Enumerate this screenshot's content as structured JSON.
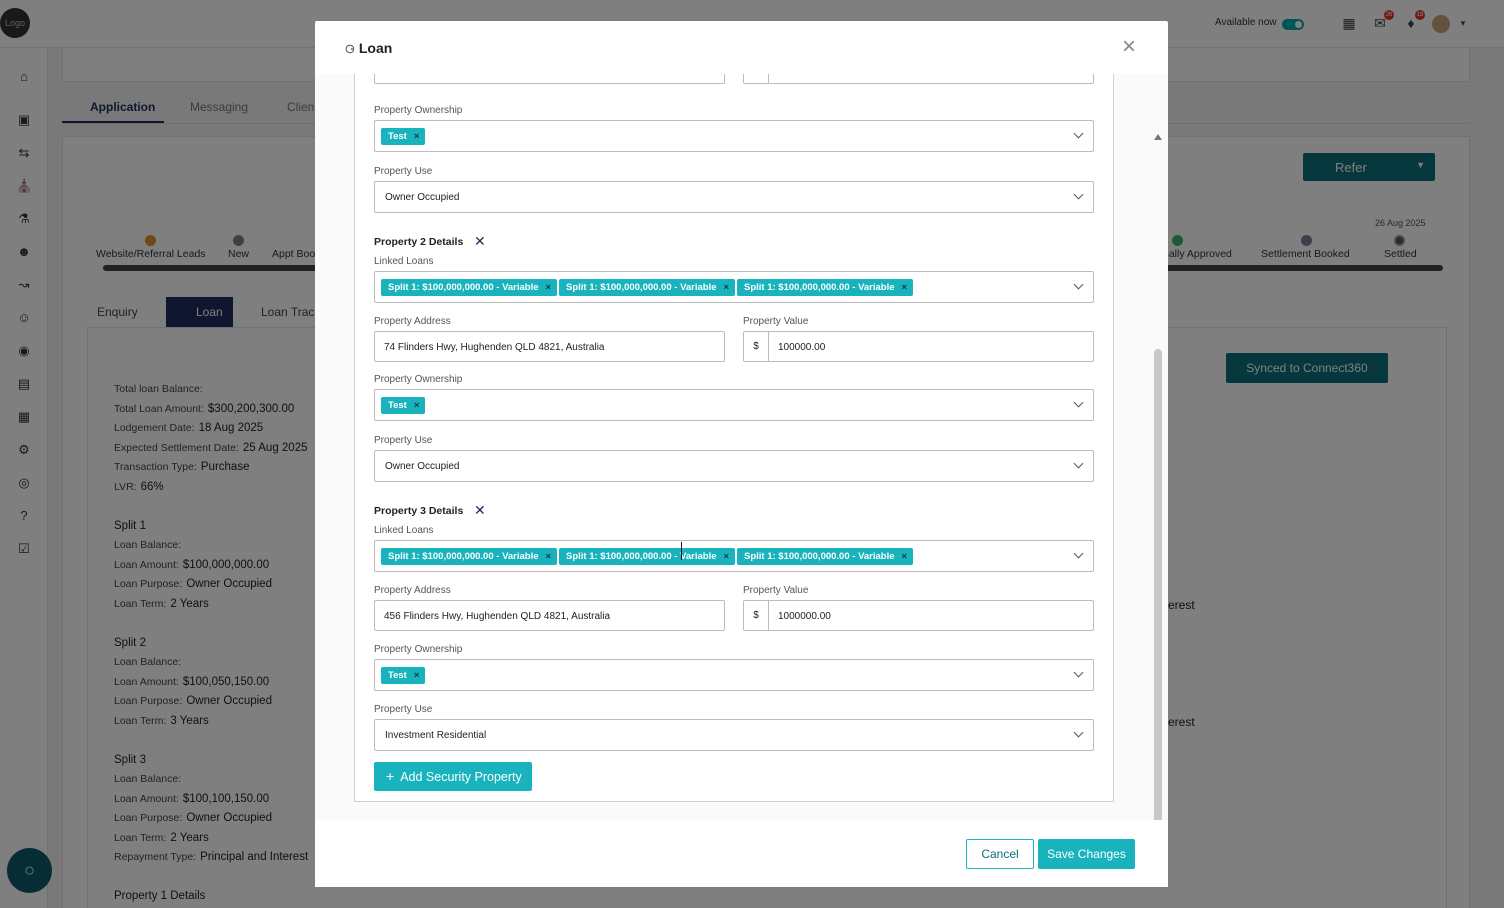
{
  "topbar": {
    "logo_text": "Logo",
    "availability_label": "Available now",
    "badges": [
      "26",
      "18",
      "40"
    ]
  },
  "background": {
    "tabs": [
      "Application",
      "Messaging",
      "Clien"
    ],
    "refer_label": "Refer",
    "stage_date": "26 Aug 2025",
    "stages_left": [
      "Website/Referral Leads",
      "New",
      "Appt Boo"
    ],
    "stages_right": [
      "nally Approved",
      "Settlement Booked",
      "Settled"
    ],
    "subtabs": [
      "Enquiry",
      "Loan",
      "Loan Track"
    ],
    "synced_label": "Synced to Connect360",
    "summary": [
      {
        "label": "Total loan Balance:",
        "value": ""
      },
      {
        "label": "Total Loan Amount:",
        "value": "$300,200,300.00"
      },
      {
        "label": "Lodgement Date:",
        "value": "18 Aug 2025"
      },
      {
        "label": "Expected Settlement Date:",
        "value": "25 Aug 2025"
      },
      {
        "label": "Transaction Type:",
        "value": "Purchase"
      },
      {
        "label": "LVR:",
        "value": "66%"
      }
    ],
    "splits": [
      {
        "title": "Split 1",
        "balance_label": "Loan Balance:",
        "amount_label": "Loan Amount:",
        "amount": "$100,000,000.00",
        "purpose_label": "Loan Purpose:",
        "purpose": "Owner Occupied",
        "term_label": "Loan Term:",
        "term": "2 Years"
      },
      {
        "title": "Split 2",
        "balance_label": "Loan Balance:",
        "amount_label": "Loan Amount:",
        "amount": "$100,050,150.00",
        "purpose_label": "Loan Purpose:",
        "purpose": "Owner Occupied",
        "term_label": "Loan Term:",
        "term": "3 Years"
      },
      {
        "title": "Split 3",
        "balance_label": "Loan Balance:",
        "amount_label": "Loan Amount:",
        "amount": "$100,100,150.00",
        "purpose_label": "Loan Purpose:",
        "purpose": "Owner Occupied",
        "term_label": "Loan Term:",
        "term": "2 Years"
      }
    ],
    "repayment_label": "Repayment Type:",
    "repayment_value": "Principal and Interest",
    "property1_title": "Property 1 Details",
    "right_text": "erest"
  },
  "modal": {
    "title": "Loan",
    "labels": {
      "linked_loans": "Linked Loans",
      "property_address": "Property Address",
      "property_value": "Property Value",
      "property_ownership": "Property Ownership",
      "property_use": "Property Use"
    },
    "currency_prefix": "$",
    "property1": {
      "ownership_tags": [
        "Test"
      ],
      "use": "Owner Occupied"
    },
    "property2": {
      "title": "Property 2 Details",
      "linked_loans": [
        "Split 1: $100,000,000.00 - Variable",
        "Split 1: $100,000,000.00 - Variable",
        "Split 1: $100,000,000.00 - Variable"
      ],
      "address": "74 Flinders Hwy, Hughenden QLD 4821, Australia",
      "value": "100000.00",
      "ownership_tags": [
        "Test"
      ],
      "use": "Owner Occupied"
    },
    "property3": {
      "title": "Property 3 Details",
      "linked_loans": [
        "Split 1: $100,000,000.00 - Variable",
        "Split 1: $100,000,000.00 - Variable",
        "Split 1: $100,000,000.00 - Variable"
      ],
      "address": "456 Flinders Hwy, Hughenden QLD 4821, Australia",
      "value": "1000000.00",
      "ownership_tags": [
        "Test"
      ],
      "use": "Investment Residential"
    },
    "add_property_label": "Add Security Property",
    "cancel_label": "Cancel",
    "save_label": "Save Changes"
  }
}
